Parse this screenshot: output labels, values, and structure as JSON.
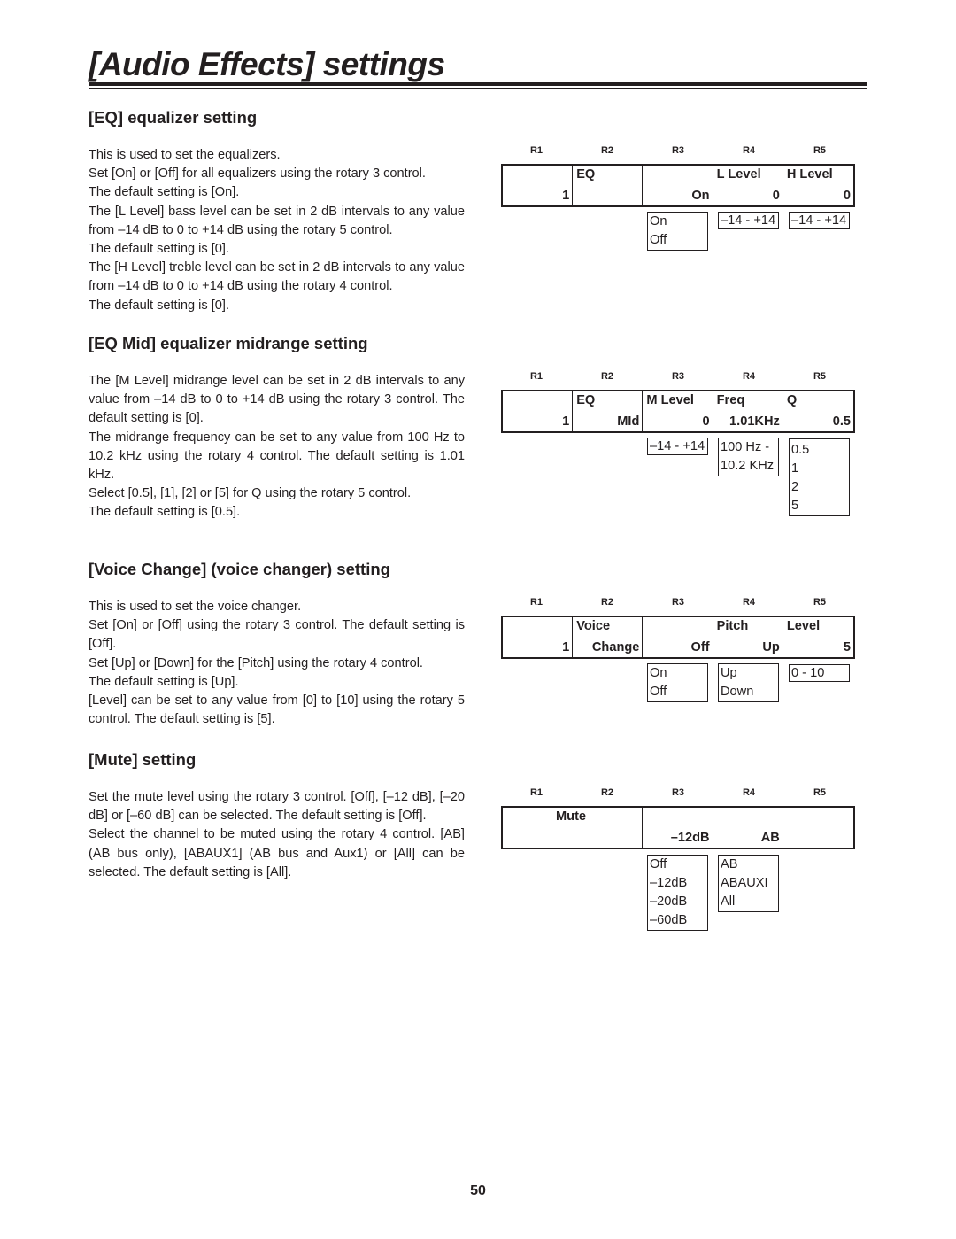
{
  "page": {
    "title": "[Audio Effects] settings",
    "page_number": "50"
  },
  "rotary_labels": [
    "R1",
    "R2",
    "R3",
    "R4",
    "R5"
  ],
  "sections": {
    "eq": {
      "heading": "[EQ] equalizer setting",
      "paragraphs": [
        "This is used to set the equalizers.",
        "Set [On] or [Off] for all equalizers using the rotary 3 control.",
        "The default setting is [On].",
        "The [L Level] bass level can be set in 2 dB intervals to any value from –14 dB to 0 to +14 dB using the rotary 5 control.",
        "The default setting is [0].",
        "The [H Level] treble level can be set in 2 dB intervals to any value from –14 dB to 0 to +14 dB using the rotary 4 control.",
        "The default setting is [0]."
      ],
      "panel": {
        "r1": {
          "top": "",
          "bottom": "1"
        },
        "r2": {
          "top": "EQ",
          "bottom": ""
        },
        "r3": {
          "top": "",
          "bottom": "On"
        },
        "r4": {
          "top": "L Level",
          "bottom": "0"
        },
        "r5": {
          "top": "H Level",
          "bottom": "0"
        }
      },
      "options": {
        "r3": [
          "On",
          "Off"
        ],
        "r4": [
          "–14 - +14"
        ],
        "r5": [
          "–14 - +14"
        ]
      }
    },
    "eq_mid": {
      "heading": "[EQ Mid] equalizer midrange setting",
      "paragraphs": [
        "The [M Level] midrange level can be set in 2 dB intervals to any value from –14 dB to 0 to +14 dB using the rotary 3 control.  The default setting is [0].",
        "The midrange frequency can be set to any value from 100 Hz to 10.2 kHz using the rotary 4 control.  The default setting is 1.01 kHz.",
        "Select [0.5], [1], [2] or [5] for Q using the rotary 5 control.",
        "The default setting is [0.5]."
      ],
      "panel": {
        "r1": {
          "top": "",
          "bottom": "1"
        },
        "r2": {
          "top": "EQ",
          "bottom": "MId"
        },
        "r3": {
          "top": "M Level",
          "bottom": "0"
        },
        "r4": {
          "top": "Freq",
          "bottom": "1.01KHz"
        },
        "r5": {
          "top": "Q",
          "bottom": "0.5"
        }
      },
      "options": {
        "r3": [
          "–14 - +14"
        ],
        "r4": [
          "100 Hz -",
          "10.2 KHz"
        ],
        "r5": [
          "0.5",
          "1",
          "2",
          "5"
        ]
      }
    },
    "voice_change": {
      "heading": "[Voice Change] (voice changer) setting",
      "paragraphs": [
        "This is used to set the voice changer.",
        "Set [On] or [Off] using the rotary 3 control.  The default setting is [Off].",
        "Set [Up] or [Down] for the [Pitch] using the rotary 4 control.",
        "The default setting is [Up].",
        "[Level] can be set to any value from [0] to [10] using the rotary 5 control.  The default setting is [5]."
      ],
      "panel": {
        "r1": {
          "top": "",
          "bottom": "1"
        },
        "r2": {
          "top": "Voice",
          "bottom": "Change"
        },
        "r3": {
          "top": "",
          "bottom": "Off"
        },
        "r4": {
          "top": "Pitch",
          "bottom": "Up"
        },
        "r5": {
          "top": "Level",
          "bottom": "5"
        }
      },
      "options": {
        "r3": [
          "On",
          "Off"
        ],
        "r4": [
          "Up",
          "Down"
        ],
        "r5": [
          "0 - 10"
        ]
      }
    },
    "mute": {
      "heading": "[Mute] setting",
      "paragraphs": [
        "Set the mute level using the rotary 3 control.  [Off], [–12 dB], [–20 dB] or [–60 dB] can be selected.  The default setting is [Off].",
        "Select the channel to be muted using the rotary 4 control. [AB] (AB bus only), [ABAUX1] (AB bus and Aux1) or [All] can be selected.  The default setting is [All]."
      ],
      "panel": {
        "r1r2": {
          "top": "Mute",
          "bottom": ""
        },
        "r3": {
          "top": "",
          "bottom": "–12dB"
        },
        "r4": {
          "top": "",
          "bottom": "AB"
        },
        "r5": {
          "top": "",
          "bottom": ""
        }
      },
      "options": {
        "r3": [
          "Off",
          "–12dB",
          "–20dB",
          "–60dB"
        ],
        "r4": [
          "AB",
          "ABAUXI",
          "All"
        ]
      }
    }
  }
}
